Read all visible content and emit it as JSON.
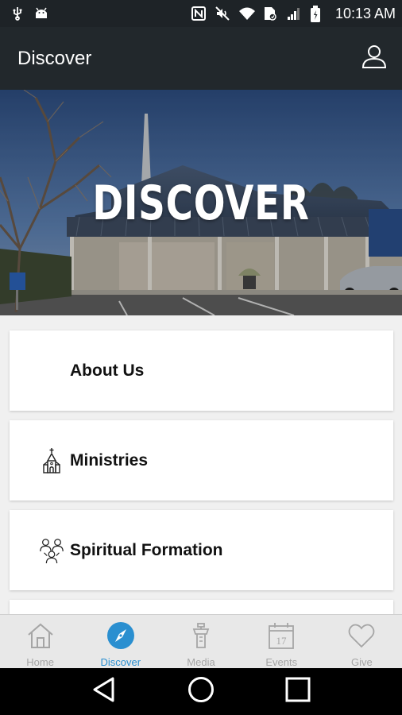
{
  "status_bar": {
    "time": "10:13 AM",
    "icons_left": [
      "usb-icon",
      "android-debug-icon"
    ],
    "icons_right": [
      "nfc-icon",
      "mute-icon",
      "wifi-icon",
      "data-saver-icon",
      "signal-icon",
      "battery-icon"
    ]
  },
  "app_bar": {
    "title": "Discover",
    "profile_icon": "person-outline-icon"
  },
  "hero": {
    "title": "DISCOVER"
  },
  "cards": [
    {
      "label": "About Us",
      "icon": ""
    },
    {
      "label": "Ministries",
      "icon": "church-icon"
    },
    {
      "label": "Spiritual Formation",
      "icon": "people-group-icon"
    },
    {
      "label": "",
      "icon": ""
    }
  ],
  "bottom_nav": {
    "items": [
      {
        "label": "Home",
        "icon": "home-icon",
        "active": false
      },
      {
        "label": "Discover",
        "icon": "compass-icon",
        "active": true
      },
      {
        "label": "Media",
        "icon": "podium-icon",
        "active": false
      },
      {
        "label": "Events",
        "icon": "calendar-icon",
        "active": false,
        "calendar_day": "17"
      },
      {
        "label": "Give",
        "icon": "heart-icon",
        "active": false
      }
    ]
  },
  "colors": {
    "app_bar": "#22282c",
    "status_bar": "#1e2327",
    "accent": "#2a8fd0",
    "nav_inactive": "#a5a5a5",
    "content_bg": "#f0f0f0"
  }
}
